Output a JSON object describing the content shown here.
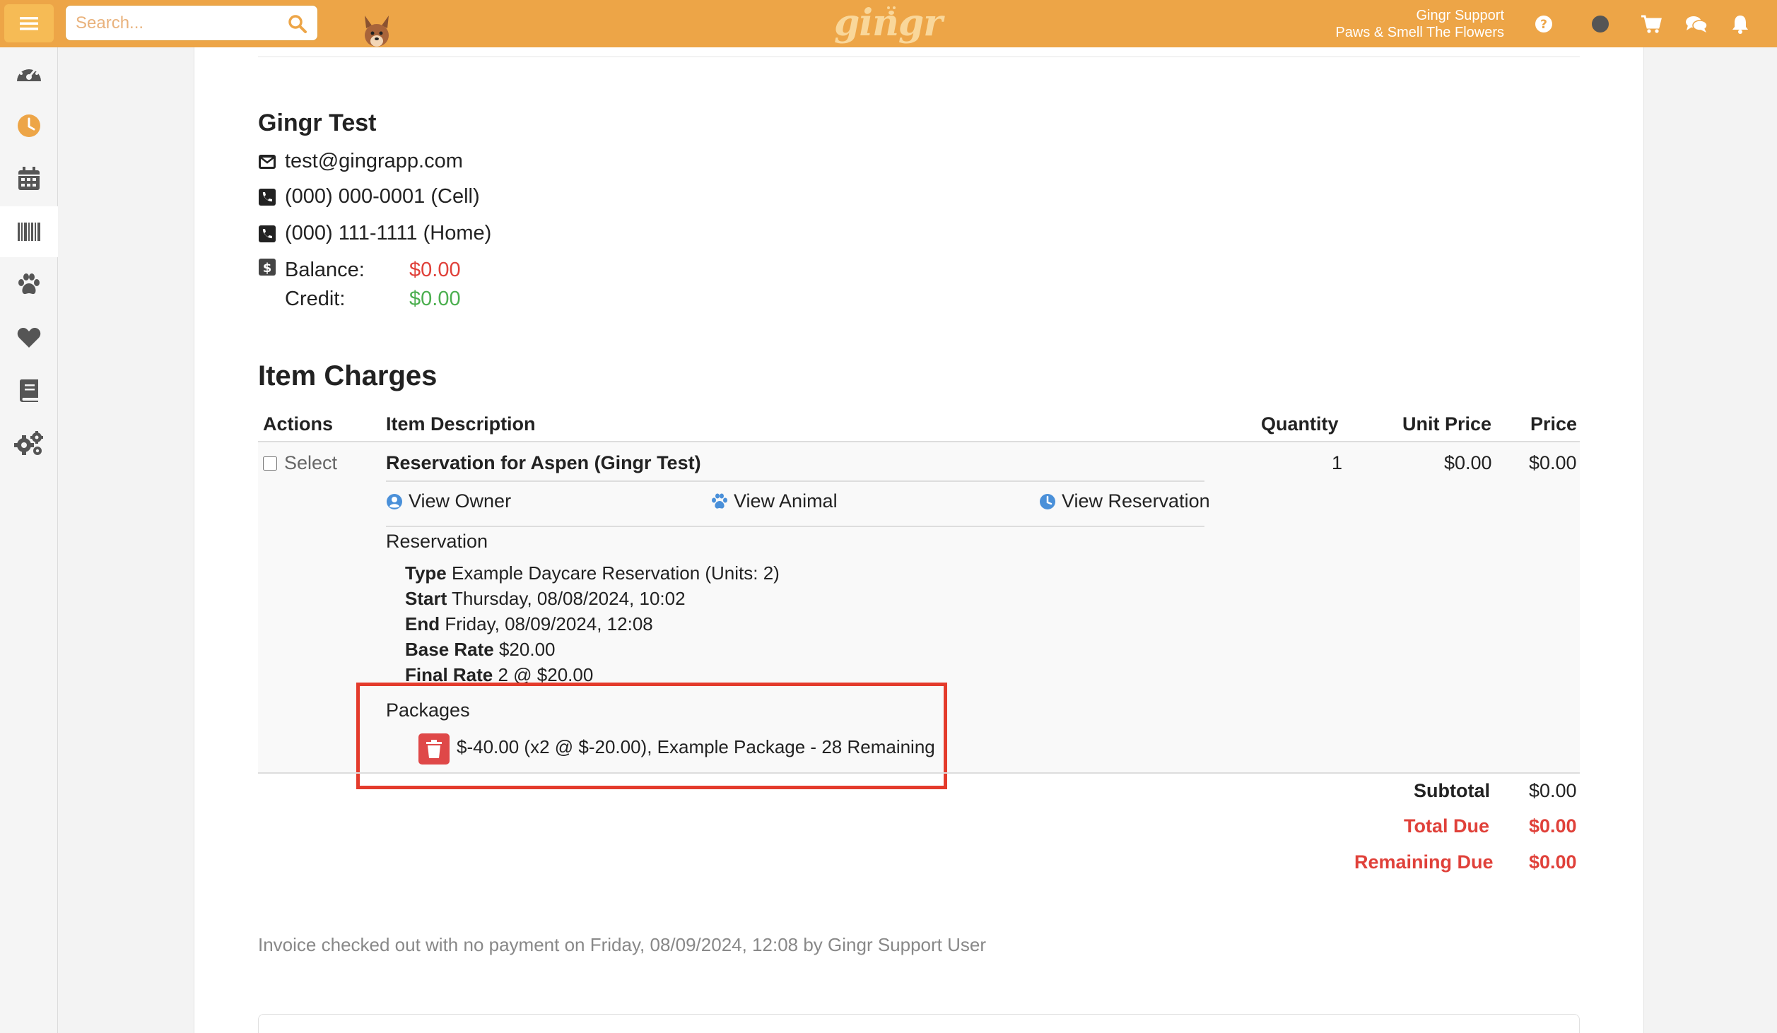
{
  "topbar": {
    "search_placeholder": "Search...",
    "logo_text": "gingr",
    "user_name": "Gingr Support",
    "location_name": "Paws & Smell The Flowers",
    "icons": [
      "menu-icon",
      "search-icon",
      "help-icon",
      "status-dot-icon",
      "cart-icon",
      "chat-icon",
      "bell-icon"
    ],
    "accent_color": "#eda547"
  },
  "sidebar": {
    "items": [
      {
        "name": "dashboard",
        "icon": "speedometer-icon"
      },
      {
        "name": "reservations",
        "icon": "clock-icon"
      },
      {
        "name": "calendar",
        "icon": "calendar-icon"
      },
      {
        "name": "point-of-sale",
        "icon": "barcode-icon"
      },
      {
        "name": "animals",
        "icon": "paw-icon"
      },
      {
        "name": "owners",
        "icon": "heart-icon"
      },
      {
        "name": "reports",
        "icon": "book-icon"
      },
      {
        "name": "admin",
        "icon": "gears-icon"
      }
    ]
  },
  "customer": {
    "name": "Gingr Test",
    "email": "test@gingrapp.com",
    "phone_cell": "(000) 000-0001 (Cell)",
    "phone_home": "(000) 111-1111 (Home)",
    "balance_label": "Balance:",
    "balance_value": "$0.00",
    "credit_label": "Credit:",
    "credit_value": "$0.00"
  },
  "charges": {
    "title": "Item Charges",
    "columns": {
      "actions": "Actions",
      "description": "Item Description",
      "quantity": "Quantity",
      "unit_price": "Unit Price",
      "price": "Price"
    },
    "item": {
      "select_label": "Select",
      "title": "Reservation for Aspen (Gingr Test)",
      "quantity": "1",
      "unit_price": "$0.00",
      "price": "$0.00",
      "links": {
        "view_owner": "View Owner",
        "view_animal": "View Animal",
        "view_reservation": "View Reservation"
      },
      "reservation_heading": "Reservation",
      "details": {
        "type_label": "Type",
        "type_value": "Example Daycare Reservation (Units: 2)",
        "start_label": "Start",
        "start_value": "Thursday, 08/08/2024, 10:02",
        "end_label": "End",
        "end_value": "Friday, 08/09/2024, 12:08",
        "base_rate_label": "Base Rate",
        "base_rate_value": "$20.00",
        "final_rate_label": "Final Rate",
        "final_rate_value": "2 @ $20.00"
      },
      "packages_heading": "Packages",
      "package_line": "$-40.00 (x2 @ $-20.00), Example Package - 28 Remaining"
    },
    "totals": {
      "subtotal_label": "Subtotal",
      "subtotal_value": "$0.00",
      "total_due_label": "Total Due",
      "total_due_value": "$0.00",
      "remaining_due_label": "Remaining Due",
      "remaining_due_value": "$0.00"
    }
  },
  "footnote": "Invoice checked out with no payment on Friday, 08/09/2024, 12:08 by Gingr Support User",
  "colors": {
    "negative": "#e0413a",
    "positive": "#4caf50",
    "highlight_box": "#e43b2c",
    "link_icon": "#4a90d9"
  }
}
